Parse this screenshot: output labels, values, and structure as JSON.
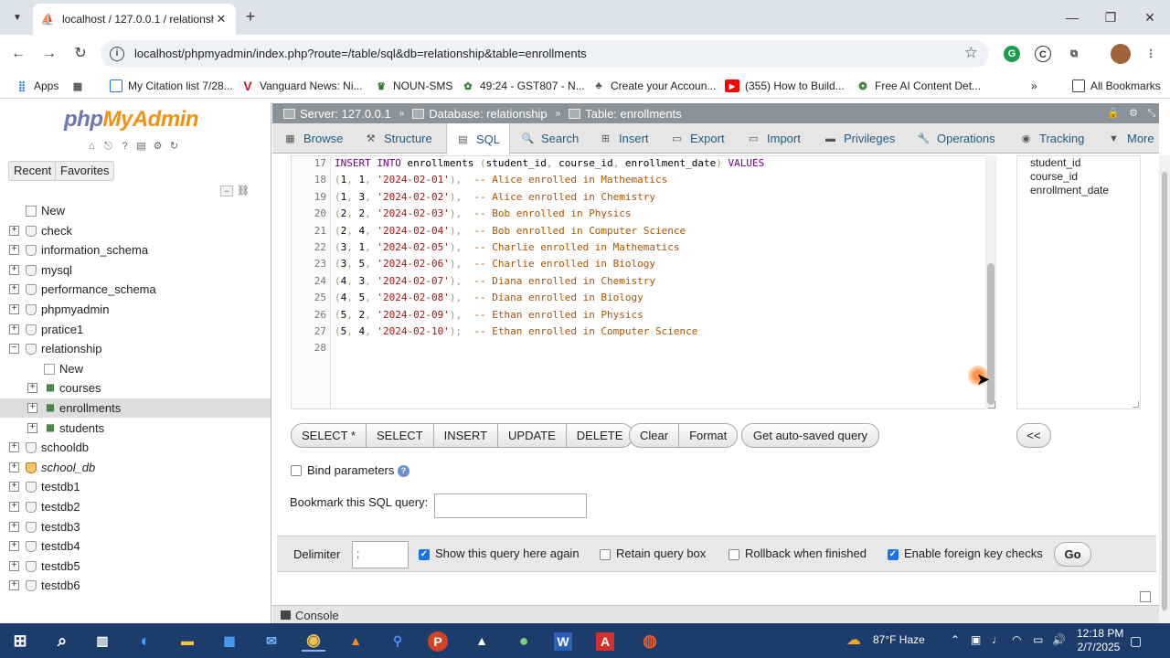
{
  "browser": {
    "tab_title": "localhost / 127.0.0.1 / relationshi",
    "url": "localhost/phpmyadmin/index.php?route=/table/sql&db=relationship&table=enrollments",
    "bookmarks": [
      {
        "label": "Apps",
        "icon": "apps-grid-icon"
      },
      {
        "label": "My Citation list 7/28...",
        "icon": "bookmark-page-icon"
      },
      {
        "label": "Vanguard News: Ni...",
        "icon": "vanguard-v-icon"
      },
      {
        "label": "NOUN-SMS",
        "icon": "noun-logo-icon"
      },
      {
        "label": "49:24 - GST807 - N...",
        "icon": "gst-logo-icon"
      },
      {
        "label": "Create your Accoun...",
        "icon": "account-icon"
      },
      {
        "label": "(355) How to Build...",
        "icon": "youtube-icon"
      },
      {
        "label": "Free AI Content Det...",
        "icon": "ai-detector-icon"
      }
    ],
    "all_bookmarks": "All Bookmarks"
  },
  "pma": {
    "logo_php": "php",
    "logo_admin": "MyAdmin",
    "tabs": {
      "recent": "Recent",
      "favorites": "Favorites"
    },
    "tree": [
      {
        "label": "New",
        "type": "new",
        "level": 0
      },
      {
        "label": "check",
        "type": "db",
        "level": 0
      },
      {
        "label": "information_schema",
        "type": "db",
        "level": 0
      },
      {
        "label": "mysql",
        "type": "db",
        "level": 0
      },
      {
        "label": "performance_schema",
        "type": "db",
        "level": 0
      },
      {
        "label": "phpmyadmin",
        "type": "db",
        "level": 0
      },
      {
        "label": "pratice1",
        "type": "db",
        "level": 0
      },
      {
        "label": "relationship",
        "type": "db-open",
        "level": 0
      },
      {
        "label": "New",
        "type": "new",
        "level": 1
      },
      {
        "label": "courses",
        "type": "table",
        "level": 1
      },
      {
        "label": "enrollments",
        "type": "table-active",
        "level": 1
      },
      {
        "label": "students",
        "type": "table",
        "level": 1
      },
      {
        "label": "schooldb",
        "type": "db",
        "level": 0
      },
      {
        "label": "school_db",
        "type": "db-italic",
        "level": 0
      },
      {
        "label": "testdb1",
        "type": "db",
        "level": 0
      },
      {
        "label": "testdb2",
        "type": "db",
        "level": 0
      },
      {
        "label": "testdb3",
        "type": "db",
        "level": 0
      },
      {
        "label": "testdb4",
        "type": "db",
        "level": 0
      },
      {
        "label": "testdb5",
        "type": "db",
        "level": 0
      },
      {
        "label": "testdb6",
        "type": "db",
        "level": 0
      }
    ],
    "breadcrumb": {
      "server": "Server: 127.0.0.1",
      "database": "Database: relationship",
      "table": "Table: enrollments"
    },
    "menu": [
      "Browse",
      "Structure",
      "SQL",
      "Search",
      "Insert",
      "Export",
      "Import",
      "Privileges",
      "Operations",
      "Tracking",
      "More"
    ],
    "sql_lines": [
      {
        "n": "17",
        "text": "INSERT INTO enrollments (student_id, course_id, enrollment_date) VALUES"
      },
      {
        "n": "18",
        "text": "(1, 1, '2024-02-01'),  -- Alice enrolled in Mathematics"
      },
      {
        "n": "19",
        "text": "(1, 3, '2024-02-02'),  -- Alice enrolled in Chemistry"
      },
      {
        "n": "20",
        "text": "(2, 2, '2024-02-03'),  -- Bob enrolled in Physics"
      },
      {
        "n": "21",
        "text": "(2, 4, '2024-02-04'),  -- Bob enrolled in Computer Science"
      },
      {
        "n": "22",
        "text": "(3, 1, '2024-02-05'),  -- Charlie enrolled in Mathematics"
      },
      {
        "n": "23",
        "text": "(3, 5, '2024-02-06'),  -- Charlie enrolled in Biology"
      },
      {
        "n": "24",
        "text": "(4, 3, '2024-02-07'),  -- Diana enrolled in Chemistry"
      },
      {
        "n": "25",
        "text": "(4, 5, '2024-02-08'),  -- Diana enrolled in Biology"
      },
      {
        "n": "26",
        "text": "(5, 2, '2024-02-09'),  -- Ethan enrolled in Physics"
      },
      {
        "n": "27",
        "text": "(5, 4, '2024-02-10');  -- Ethan enrolled in Computer Science"
      },
      {
        "n": "28",
        "text": ""
      }
    ],
    "columns": [
      "student_id",
      "course_id",
      "enrollment_date"
    ],
    "buttons": {
      "select_star": "SELECT *",
      "select": "SELECT",
      "insert": "INSERT",
      "update": "UPDATE",
      "delete": "DELETE",
      "clear": "Clear",
      "format": "Format",
      "autosaved": "Get auto-saved query",
      "collapse": "<<"
    },
    "bind_parameters": "Bind parameters",
    "bookmark_label": "Bookmark this SQL query:",
    "bookmark_value": "",
    "options": {
      "delimiter_label": "Delimiter",
      "delimiter_value": ";",
      "show_again": "Show this query here again",
      "retain": "Retain query box",
      "rollback": "Rollback when finished",
      "foreign_keys": "Enable foreign key checks",
      "go": "Go"
    },
    "console": "Console"
  },
  "taskbar": {
    "weather": "87°F  Haze",
    "time": "12:18 PM",
    "date": "2/7/2025"
  }
}
